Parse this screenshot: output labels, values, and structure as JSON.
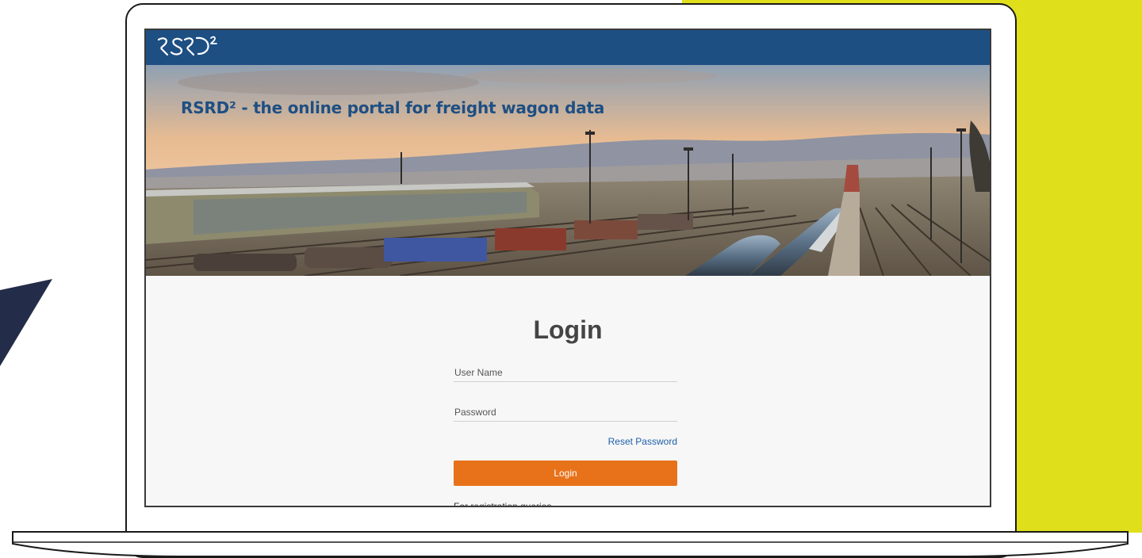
{
  "header": {
    "logo_alt": "RSRD²"
  },
  "hero": {
    "title": "RSRD² - the online portal for freight wagon data"
  },
  "login": {
    "title": "Login",
    "username_placeholder": "User Name",
    "username_value": "",
    "password_placeholder": "Password",
    "password_value": "",
    "reset_password_label": "Reset Password",
    "login_button_label": "Login",
    "registration_text": "For registration queries"
  },
  "colors": {
    "topbar": "#1e4f83",
    "accent_orange": "#e8721a",
    "link_blue": "#1e5fa8",
    "background_yellow": "#dfe01b",
    "wedge_navy": "#232c48"
  },
  "icons": {
    "logo": "rsrd2-logo"
  }
}
